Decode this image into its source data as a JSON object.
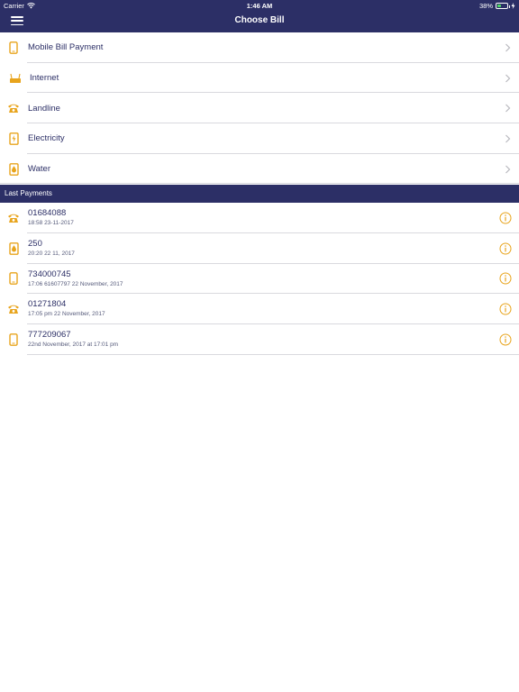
{
  "status_bar": {
    "carrier": "Carrier",
    "time": "1:46 AM",
    "battery_percent": "38%",
    "battery_level": 0.38
  },
  "nav": {
    "title": "Choose Bill"
  },
  "bills": [
    {
      "label": "Mobile Bill Payment",
      "icon": "mobile-icon"
    },
    {
      "label": "Internet",
      "icon": "router-icon"
    },
    {
      "label": "Landline",
      "icon": "telephone-icon"
    },
    {
      "label": "Electricity",
      "icon": "electricity-meter-icon"
    },
    {
      "label": "Water",
      "icon": "water-meter-icon"
    }
  ],
  "last_payments": {
    "header": "Last Payments",
    "items": [
      {
        "number": "01684088",
        "time": "18:58 23-11-2017",
        "icon": "telephone-icon"
      },
      {
        "number": "250",
        "time": "20:20 22 11, 2017",
        "icon": "water-meter-icon"
      },
      {
        "number": "734000745",
        "time": "17:06 61607797 22 November, 2017",
        "icon": "mobile-icon"
      },
      {
        "number": "01271804",
        "time": "17:05 pm 22 November, 2017",
        "icon": "telephone-icon"
      },
      {
        "number": "777209067",
        "time": "22nd November, 2017 at 17:01 pm",
        "icon": "mobile-icon"
      }
    ]
  },
  "colors": {
    "primary": "#2c2f66",
    "accent": "#e8a41c",
    "separator": "#d9d9de"
  }
}
